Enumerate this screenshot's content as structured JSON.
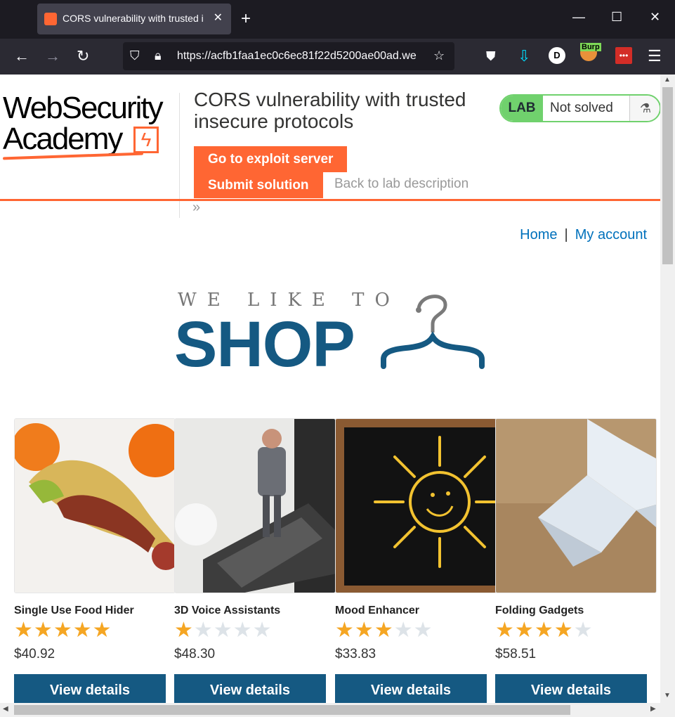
{
  "browser": {
    "tab_title": "CORS vulnerability with trusted i",
    "url": "https://acfb1faa1ec0c6ec81f22d5200ae00ad.we",
    "ext_burp_label": "Burp",
    "ext_profile_letter": "D",
    "ext_pw_label": "•••"
  },
  "header": {
    "logo_line1": "WebSecurity",
    "logo_line2": "Academy",
    "lab_title": "CORS vulnerability with trusted insecure protocols",
    "exploit_button": "Go to exploit server",
    "submit_button": "Submit solution",
    "back_link": "Back to lab description",
    "chevrons": "»",
    "badge_lab": "LAB",
    "badge_status": "Not solved",
    "accent_color": "#ff6633",
    "status_color": "#70d16d"
  },
  "nav": {
    "home": "Home",
    "separator": "|",
    "my_account": "My account"
  },
  "hero": {
    "tagline": "WE LIKE TO",
    "word": "SHOP"
  },
  "products": [
    {
      "name": "Single Use Food Hider",
      "rating": 5,
      "price": "$40.92",
      "button": "View details"
    },
    {
      "name": "3D Voice Assistants",
      "rating": 1,
      "price": "$48.30",
      "button": "View details"
    },
    {
      "name": "Mood Enhancer",
      "rating": 3,
      "price": "$33.83",
      "button": "View details"
    },
    {
      "name": "Folding Gadgets",
      "rating": 4,
      "price": "$58.51",
      "button": "View details"
    }
  ]
}
